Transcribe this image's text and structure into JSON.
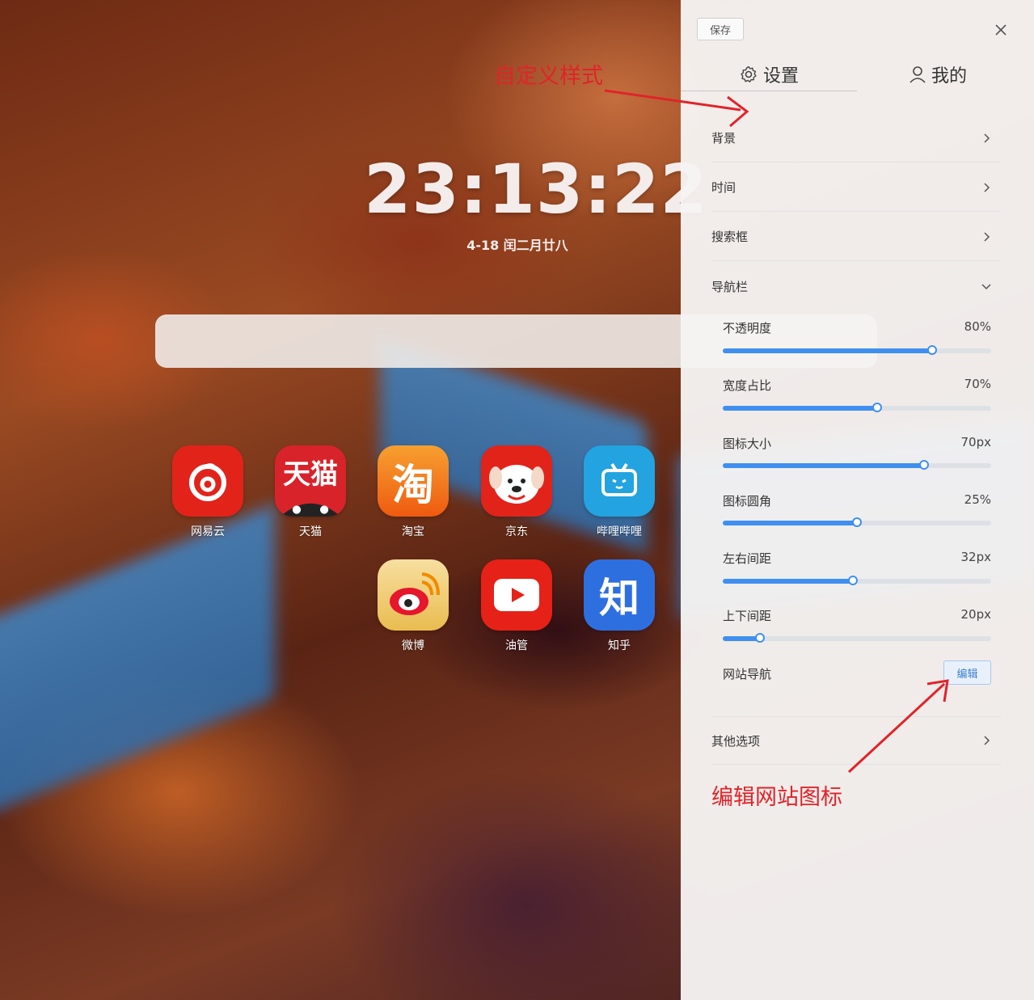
{
  "clock": {
    "time": "23:13:22",
    "date": "4-18 闰二月廿八"
  },
  "nav_sites": [
    {
      "label": "网易云",
      "icon": "netease-music-icon",
      "color": "#e2231a"
    },
    {
      "label": "天猫",
      "icon": "tmall-icon",
      "color": "#d8232a",
      "text": "天猫"
    },
    {
      "label": "淘宝",
      "icon": "taobao-icon",
      "color": "#f06a10",
      "text": "淘"
    },
    {
      "label": "京东",
      "icon": "jd-icon",
      "color": "#e2231a"
    },
    {
      "label": "哔哩哔哩",
      "icon": "bilibili-icon",
      "color": "#23a3e0"
    },
    {
      "label": "微博",
      "icon": "weibo-icon",
      "color": "#f0c860"
    },
    {
      "label": "油管",
      "icon": "youtube-icon",
      "color": "#e62117"
    },
    {
      "label": "知乎",
      "icon": "zhihu-icon",
      "color": "#2e6fe0",
      "text": "知"
    }
  ],
  "panel": {
    "save_label": "保存",
    "tabs": [
      {
        "label": "设置",
        "icon": "gear-icon"
      },
      {
        "label": "我的",
        "icon": "user-icon"
      }
    ],
    "sections": [
      "背景",
      "时间",
      "搜索框",
      "导航栏",
      "其他选项"
    ],
    "nav_settings": [
      {
        "label": "不透明度",
        "value": "80%",
        "fraction": 0.78
      },
      {
        "label": "宽度占比",
        "value": "70%",
        "fraction": 0.575
      },
      {
        "label": "图标大小",
        "value": "70px",
        "fraction": 0.75
      },
      {
        "label": "图标圆角",
        "value": "25%",
        "fraction": 0.5
      },
      {
        "label": "左右间距",
        "value": "32px",
        "fraction": 0.485
      },
      {
        "label": "上下间距",
        "value": "20px",
        "fraction": 0.14
      }
    ],
    "site_nav_label": "网站导航",
    "edit_label": "编辑"
  },
  "annotations": {
    "custom_style": "自定义样式",
    "edit_icons": "编辑网站图标",
    "color": "#e0242a"
  }
}
